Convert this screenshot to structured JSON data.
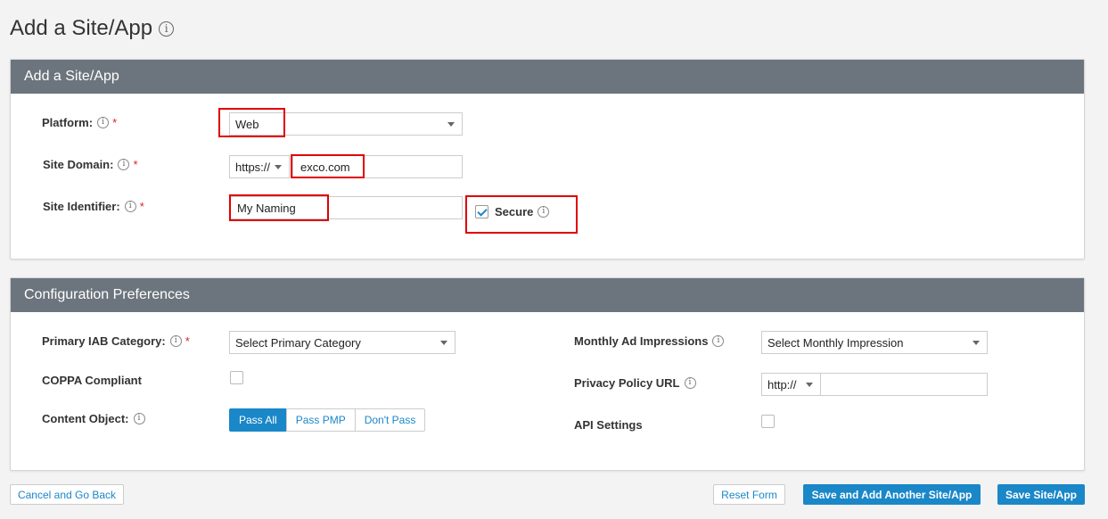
{
  "page": {
    "title": "Add a Site/App"
  },
  "site_panel": {
    "title": "Add a Site/App",
    "platform": {
      "label": "Platform:",
      "value": "Web"
    },
    "site_domain": {
      "label": "Site Domain:",
      "protocol": "https://",
      "value": "exco.com"
    },
    "site_identifier": {
      "label": "Site Identifier:",
      "value": "My Naming"
    },
    "secure": {
      "label": "Secure",
      "checked": true
    },
    "required_mark": "*"
  },
  "config_panel": {
    "title": "Configuration Preferences",
    "primary_iab": {
      "label": "Primary IAB Category:",
      "value": "Select Primary Category"
    },
    "coppa": {
      "label": "COPPA Compliant",
      "checked": false
    },
    "content_object": {
      "label": "Content Object:",
      "options": [
        "Pass All",
        "Pass PMP",
        "Don't Pass"
      ],
      "selected": "Pass All"
    },
    "monthly_impressions": {
      "label": "Monthly Ad Impressions",
      "value": "Select Monthly Impression"
    },
    "privacy_policy": {
      "label": "Privacy Policy URL",
      "protocol": "http://",
      "value": ""
    },
    "api_settings": {
      "label": "API Settings",
      "checked": false
    },
    "required_mark": "*"
  },
  "footer": {
    "cancel": "Cancel and Go Back",
    "reset": "Reset Form",
    "save_add_another": "Save and Add Another Site/App",
    "save": "Save Site/App"
  },
  "colors": {
    "accent": "#1a87c8",
    "panel_header": "#6c757d",
    "highlight": "#e00000"
  },
  "icons": {
    "info": "info-circle-icon",
    "caret": "caret-down-icon",
    "check": "check-icon"
  }
}
